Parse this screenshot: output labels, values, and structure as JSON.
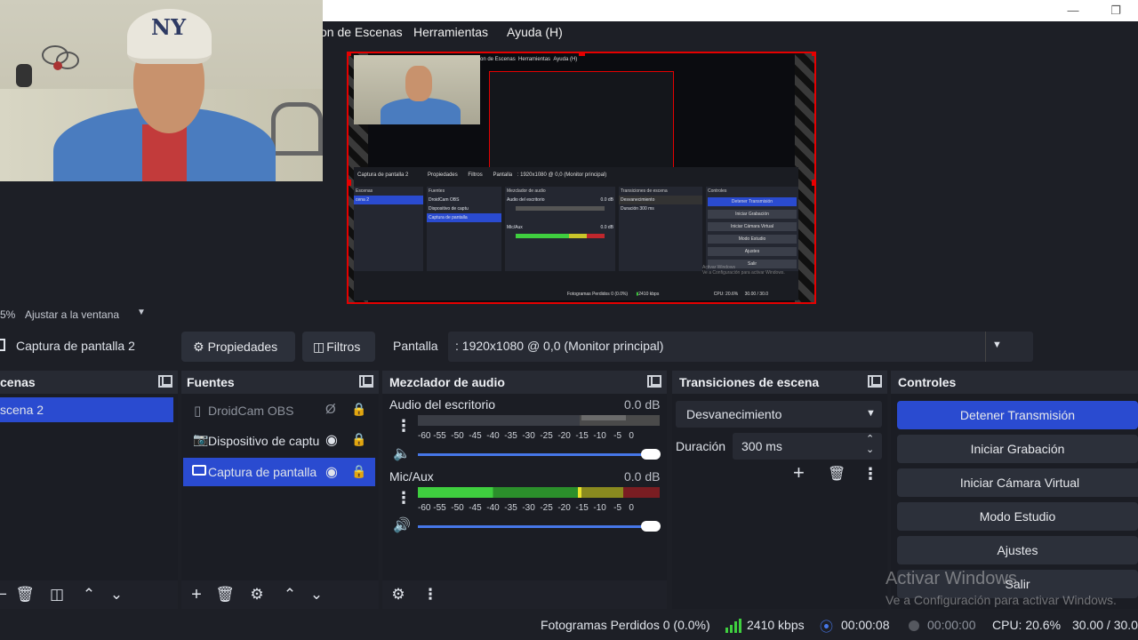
{
  "menu": {
    "items": [
      "on de Escenas",
      "Herramientas",
      "Ayuda (H)"
    ]
  },
  "mini_preview": {
    "menu": [
      "on de Escenas",
      "Herramientas",
      "Ayuda (H)"
    ],
    "source_name": "Captura de pantalla 2",
    "properties": "Propiedades",
    "filters": "Filtros",
    "pantalla": "Pantalla",
    "pantalla_value": ": 1920x1080 @ 0,0 (Monitor principal)",
    "panels": [
      "Fuentes",
      "Mezclador de audio",
      "Transiciones de escena",
      "Controles"
    ],
    "scene": "cena 2",
    "sources": [
      "DroidCam OBS",
      "Dispositivo de captu",
      "Captura de pantalla"
    ],
    "audio": [
      "Audio del escritorio",
      "Mic/Aux"
    ],
    "db": "0.0 dB",
    "transition": "Desvanecimiento",
    "duration_label": "Duración",
    "duration": "300 ms",
    "controls": [
      "Detener Transmisión",
      "Iniciar Grabación",
      "Iniciar Cámara Virtual",
      "Modo Estudio",
      "Ajustes",
      "Salir"
    ],
    "status": "Fotogramas Perdidos 0 (0.0%)",
    "bitrate": "2410 kbps",
    "cpu": "CPU: 20.6%",
    "fps": "30.00 / 30.0",
    "watermark1": "Activar Windows",
    "watermark2": "Ve a Configuración para activar Windows."
  },
  "zoom": {
    "percent": "5%",
    "fit": "Ajustar a la ventana"
  },
  "source_toolbar": {
    "source_name": "Captura de pantalla 2",
    "properties": "Propiedades",
    "filters": "Filtros",
    "pantalla_label": "Pantalla",
    "pantalla_value": ": 1920x1080 @ 0,0 (Monitor principal)"
  },
  "scenes": {
    "title": "cenas",
    "items": [
      "scena 2"
    ]
  },
  "sources": {
    "title": "Fuentes",
    "items": [
      {
        "label": "DroidCam OBS",
        "visible": false
      },
      {
        "label": "Dispositivo de captu",
        "visible": true
      },
      {
        "label": "Captura de pantalla",
        "visible": true
      }
    ]
  },
  "mixer": {
    "title": "Mezclador de audio",
    "scale": [
      "-60",
      "-55",
      "-50",
      "-45",
      "-40",
      "-35",
      "-30",
      "-25",
      "-20",
      "-15",
      "-10",
      "-5",
      "0"
    ],
    "channels": [
      {
        "name": "Audio del escritorio",
        "db": "0.0 dB",
        "muted": true,
        "volume": 1.0
      },
      {
        "name": "Mic/Aux",
        "db": "0.0 dB",
        "muted": false,
        "volume": 1.0
      }
    ]
  },
  "transitions": {
    "title": "Transiciones de escena",
    "selected": "Desvanecimiento",
    "duration_label": "Duración",
    "duration_value": "300 ms"
  },
  "controls": {
    "title": "Controles",
    "buttons": [
      "Detener Transmisión",
      "Iniciar Grabación",
      "Iniciar Cámara Virtual",
      "Modo Estudio",
      "Ajustes",
      "Salir"
    ]
  },
  "watermark": {
    "line1": "Activar Windows",
    "line2": "Ve a Configuración para activar Windows."
  },
  "status": {
    "dropped": "Fotogramas Perdidos 0 (0.0%)",
    "bitrate": "2410 kbps",
    "stream_time": "00:00:08",
    "rec_time": "00:00:00",
    "cpu": "CPU: 20.6%",
    "fps": "30.00 / 30.0"
  },
  "colors": {
    "accent": "#2a4bd0",
    "preview_border": "#e60000",
    "meter_green": "#3fcf3f",
    "meter_yellow": "#c9c52a",
    "meter_red": "#c0272d"
  }
}
